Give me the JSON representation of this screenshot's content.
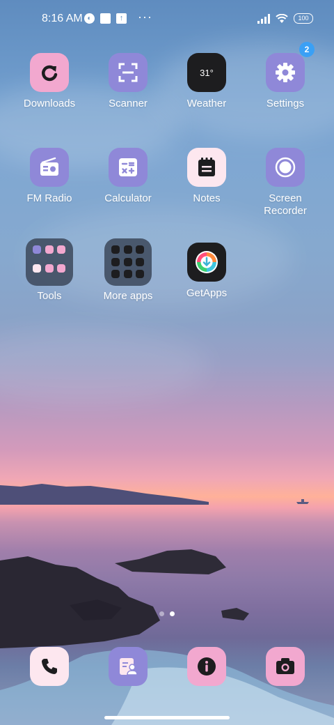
{
  "status_bar": {
    "time": "8:16 AM",
    "left_icons": [
      "data-saver-icon",
      "notification-square-icon",
      "upload-icon",
      "more-dots-icon"
    ],
    "more_dots": "···",
    "right_icons": [
      "signal-icon",
      "wifi-icon",
      "battery-icon"
    ],
    "battery_level": "100"
  },
  "apps": [
    {
      "id": "downloads",
      "label": "Downloads",
      "icon": "refresh-arrow-icon",
      "bg": "#f2a8cf"
    },
    {
      "id": "scanner",
      "label": "Scanner",
      "icon": "scan-frame-icon",
      "bg": "#8f88d8"
    },
    {
      "id": "weather",
      "label": "Weather",
      "icon": "weather-icon",
      "bg": "#1d1d1f",
      "icon_text": "31°"
    },
    {
      "id": "settings",
      "label": "Settings",
      "icon": "gear-icon",
      "bg": "#8f88d8",
      "badge": "2"
    },
    {
      "id": "fm-radio",
      "label": "FM Radio",
      "icon": "radio-icon",
      "bg": "#8f88d8"
    },
    {
      "id": "calculator",
      "label": "Calculator",
      "icon": "calculator-icon",
      "bg": "#8f88d8"
    },
    {
      "id": "notes",
      "label": "Notes",
      "icon": "notepad-icon",
      "bg": "#fde7ef"
    },
    {
      "id": "screen-recorder",
      "label": "Screen Recorder",
      "label_line1": "Screen",
      "label_line2": "Recorder",
      "icon": "record-icon",
      "bg": "#8f88d8"
    },
    {
      "id": "getapps",
      "label": "GetApps",
      "icon": "getapps-icon",
      "bg": "#1d1d1f"
    }
  ],
  "folders": [
    {
      "id": "tools",
      "label": "Tools",
      "mini_colors": [
        "#8f88d8",
        "#f2a8cf",
        "#f2a8cf",
        "#fde7ef",
        "#f2a8cf",
        "#f2a8cf"
      ]
    },
    {
      "id": "more-apps",
      "label": "More apps",
      "mini_colors": [
        "#1d1d1f",
        "#1d1d1f",
        "#1d1d1f",
        "#1d1d1f",
        "#1d1d1f",
        "#1d1d1f",
        "#1d1d1f",
        "#1d1d1f",
        "#1d1d1f"
      ]
    }
  ],
  "page_indicator": {
    "pages": 2,
    "current": 2
  },
  "dock": [
    {
      "id": "phone",
      "icon": "phone-icon",
      "bg": "#fde7ef"
    },
    {
      "id": "contacts",
      "icon": "contacts-icon",
      "bg": "#8f88d8"
    },
    {
      "id": "info",
      "icon": "info-icon",
      "bg": "#f2a8cf"
    },
    {
      "id": "camera",
      "icon": "camera-icon",
      "bg": "#f2a8cf"
    }
  ]
}
